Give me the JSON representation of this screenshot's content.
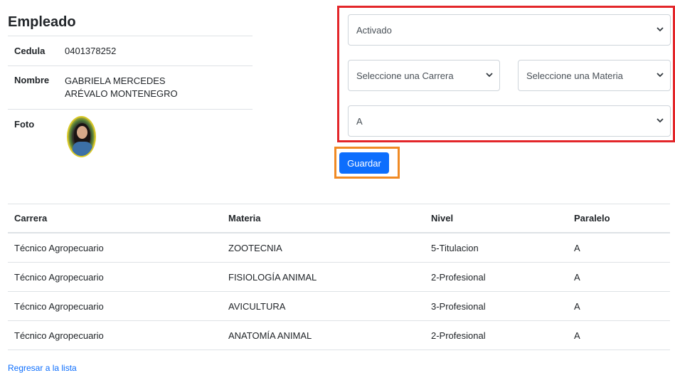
{
  "employee": {
    "title": "Empleado",
    "fields": [
      {
        "label": "Cedula",
        "value": "0401378252"
      },
      {
        "label": "Nombre",
        "value": "GABRIELA MERCEDES ARÉVALO MONTENEGRO"
      },
      {
        "label": "Foto",
        "value": ""
      }
    ]
  },
  "form": {
    "estado": "Activado",
    "carrera": "Seleccione una Carrera",
    "materia": "Seleccione una Materia",
    "paralelo": "A",
    "save_label": "Guardar"
  },
  "table": {
    "headers": [
      "Carrera",
      "Materia",
      "Nivel",
      "Paralelo"
    ],
    "rows": [
      [
        "Técnico Agropecuario",
        "ZOOTECNIA",
        "5-Titulacion",
        "A"
      ],
      [
        "Técnico Agropecuario",
        "FISIOLOGÍA ANIMAL",
        "2-Profesional",
        "A"
      ],
      [
        "Técnico Agropecuario",
        "AVICULTURA",
        "3-Profesional",
        "A"
      ],
      [
        "Técnico Agropecuario",
        "ANATOMÍA ANIMAL",
        "2-Profesional",
        "A"
      ]
    ]
  },
  "back_link": "Regresar a la lista",
  "colors": {
    "primary": "#0d6efd",
    "highlight_red": "#e3262a",
    "highlight_orange": "#f08a24"
  }
}
